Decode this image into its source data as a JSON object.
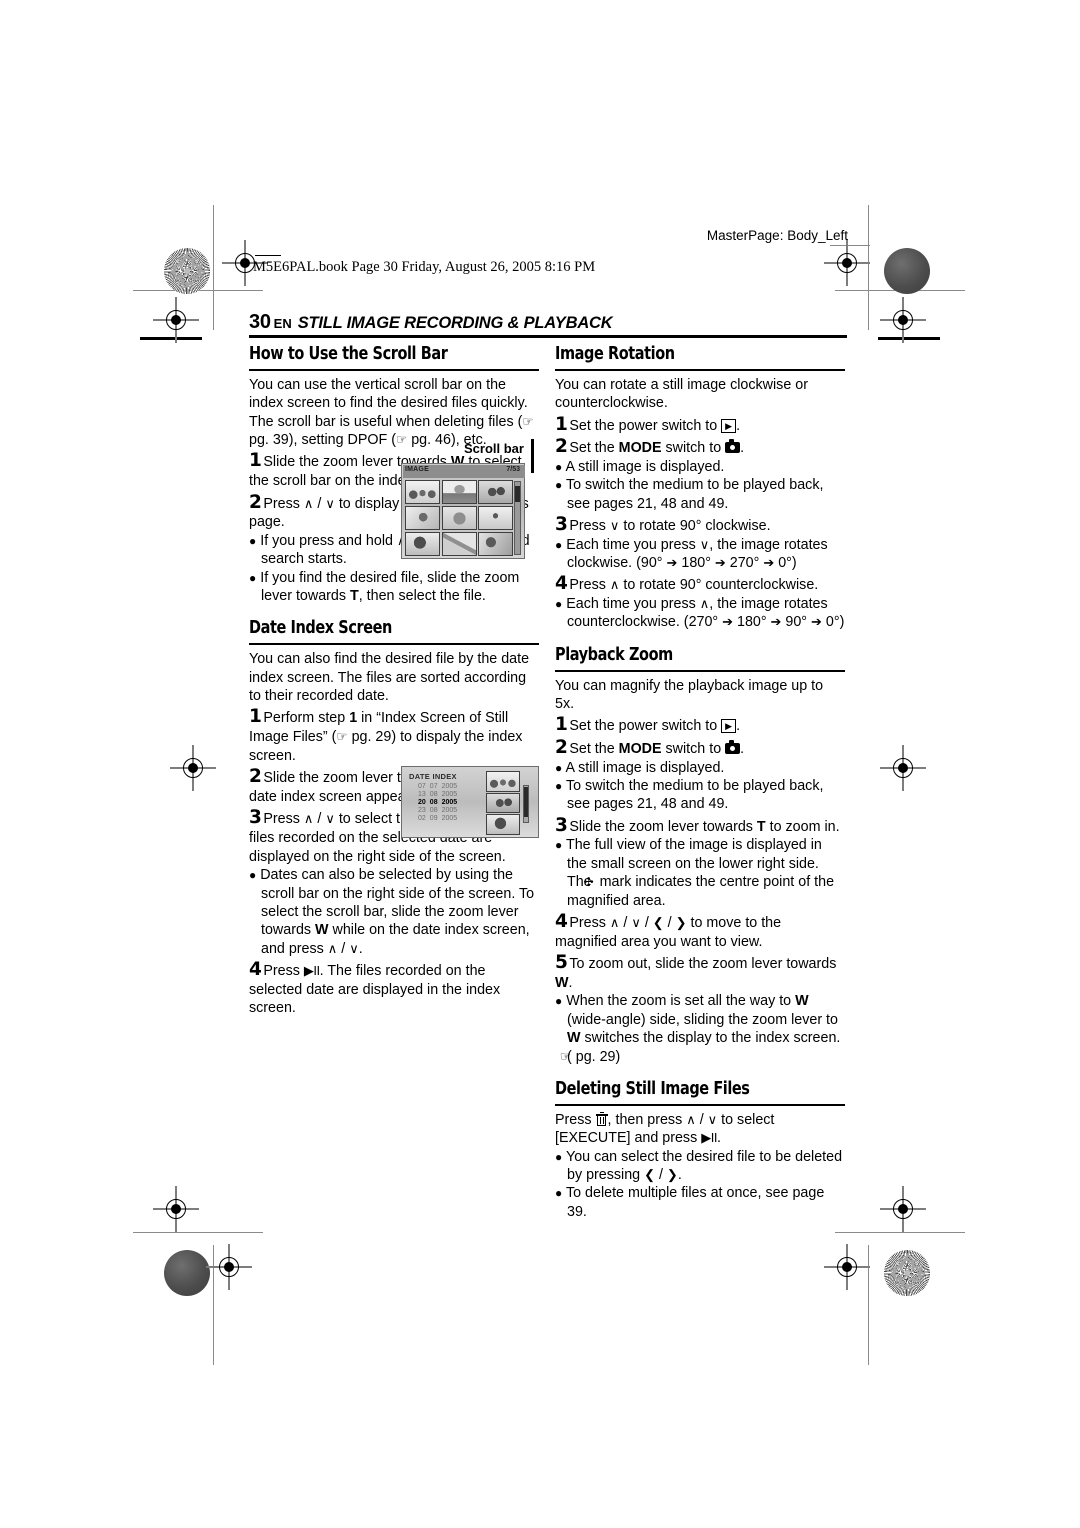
{
  "page": {
    "masterpage": "MasterPage: Body_Left",
    "bookline": "M5E6PAL.book  Page 30  Friday, August 26, 2005  8:16 PM",
    "page_number": "30",
    "lang": "EN",
    "running_title": "STILL IMAGE RECORDING & PLAYBACK"
  },
  "left_column": {
    "scroll_bar": {
      "heading": "How to Use the Scroll Bar",
      "intro": "You can use the vertical scroll bar on the index screen to find the desired files quickly. The scroll bar is useful when deleting files (",
      "intro_2": " pg. 39), setting DPOF (",
      "intro_3": " pg. 46), etc.",
      "step1_num": "1",
      "step1_a": "Slide the zoom lever towards ",
      "step1_b": "W",
      "step1_c": " to select the scroll bar on the index screen.",
      "step2_num": "2",
      "step2_a": "Press ",
      "step2_b": " to display the next or previous page.",
      "bullet1_a": "If you press and hold ",
      "bullet1_b": ", the high speed search starts.",
      "bullet2_a": "If you find the desired file, slide the zoom lever towards ",
      "bullet2_b": "T",
      "bullet2_c": ", then select the file.",
      "figure_label": "Scroll bar"
    },
    "date_index": {
      "heading": "Date Index Screen",
      "intro": "You can also find the desired file by the date index screen. The files are sorted according to their recorded date.",
      "step1_num": "1",
      "step1_a": "Perform step ",
      "step1_b": "1",
      "step1_c": " in “Index Screen of Still Image Files” (",
      "step1_d": " pg. 29) to dispaly the index screen.",
      "step2_num": "2",
      "step2_a": "Slide the zoom lever twice towards ",
      "step2_b": "W",
      "step2_c": ". The date index screen appears.",
      "step3_num": "3",
      "step3_a": "Press ",
      "step3_b": " to select the desired date. The files recorded on the selected date are displayed on the right side of the screen.",
      "bullet1_a": "Dates can also be selected by using the scroll bar on the right side of the screen. To select the scroll bar, slide the zoom lever towards ",
      "bullet1_b": "W",
      "bullet1_c": " while on the date index screen, and press ",
      "bullet1_d": ".",
      "step4_num": "4",
      "step4_a": "Press ",
      "step4_b": ". The files recorded on the selected date are displayed in the index screen."
    }
  },
  "right_column": {
    "image_rotation": {
      "heading": "Image Rotation",
      "intro": "You can rotate a still image clockwise or counterclockwise.",
      "step1_num": "1",
      "step1_a": "Set the power switch to ",
      "step1_b": ".",
      "step2_num": "2",
      "step2_a": "Set the ",
      "step2_b": "MODE",
      "step2_c": " switch to ",
      "step2_d": ".",
      "bullet1": "A still image is displayed.",
      "bullet2": "To switch the medium to be played back, see pages 21, 48 and 49.",
      "step3_num": "3",
      "step3_a": "Press ",
      "step3_b": " to rotate 90° clockwise.",
      "bullet3_a": "Each time you press ",
      "bullet3_b": ", the image rotates clockwise. (90° ",
      "bullet3_c": " 180° ",
      "bullet3_d": " 270° ",
      "bullet3_e": " 0°)",
      "step4_num": "4",
      "step4_a": "Press ",
      "step4_b": " to rotate 90° counterclockwise.",
      "bullet4_a": "Each time you press ",
      "bullet4_b": ", the image rotates counterclockwise. (270° ",
      "bullet4_c": " 180° ",
      "bullet4_d": " 90° ",
      "bullet4_e": " 0°)"
    },
    "playback_zoom": {
      "heading": "Playback Zoom",
      "intro": "You can magnify the playback image up to 5x.",
      "step1_num": "1",
      "step1_a": "Set the power switch to ",
      "step1_b": ".",
      "step2_num": "2",
      "step2_a": "Set the ",
      "step2_b": "MODE",
      "step2_c": " switch to ",
      "step2_d": ".",
      "bullet1": "A still image is displayed.",
      "bullet2": "To switch the medium to be played back, see pages 21, 48 and 49.",
      "step3_num": "3",
      "step3_a": "Slide the zoom lever towards ",
      "step3_b": "T",
      "step3_c": " to zoom in.",
      "bullet3_a": "The full view of the image is displayed in the small screen on the lower right side. The ",
      "bullet3_b": " mark indicates the centre point of the magnified area.",
      "step4_num": "4",
      "step4_a": "Press ",
      "step4_b": " to move to the magnified area you want to view.",
      "step5_num": "5",
      "step5_a": "To zoom out, slide the zoom lever towards ",
      "step5_b": "W",
      "step5_c": ".",
      "bullet5_a": "When the zoom is set all the way to ",
      "bullet5_b": "W",
      "bullet5_c": " (wide-angle) side, sliding the zoom lever to ",
      "bullet5_d": "W",
      "bullet5_e": " switches the display to the index screen. (",
      "bullet5_f": " pg. 29)"
    },
    "deleting": {
      "heading": "Deleting Still Image Files",
      "intro_a": "Press ",
      "intro_b": ", then press ",
      "intro_c": " to select [EXECUTE] and press ",
      "intro_d": ".",
      "bullet1_a": "You can select the desired file to be deleted by pressing ",
      "bullet1_b": ".",
      "bullet2": "To delete multiple files at once, see page 39."
    }
  },
  "figures": {
    "index_screen": {
      "label_left": "IMAGE",
      "label_right": "7/53"
    },
    "date_index_screen": {
      "title": "DATE INDEX",
      "rows": [
        {
          "day": "07",
          "month": "07",
          "year": "2005",
          "selected": false
        },
        {
          "day": "13",
          "month": "08",
          "year": "2005",
          "selected": false
        },
        {
          "day": "20",
          "month": "08",
          "year": "2005",
          "selected": true
        },
        {
          "day": "23",
          "month": "08",
          "year": "2005",
          "selected": false
        },
        {
          "day": "02",
          "month": "09",
          "year": "2005",
          "selected": false
        }
      ]
    }
  },
  "icons": {
    "hand": "☞",
    "up": "∧",
    "down": "∨",
    "left": "❮",
    "right": "❯",
    "arrow_right": "➔",
    "play_pause": "▶II",
    "play": "▶",
    "center_mark": "✣"
  }
}
